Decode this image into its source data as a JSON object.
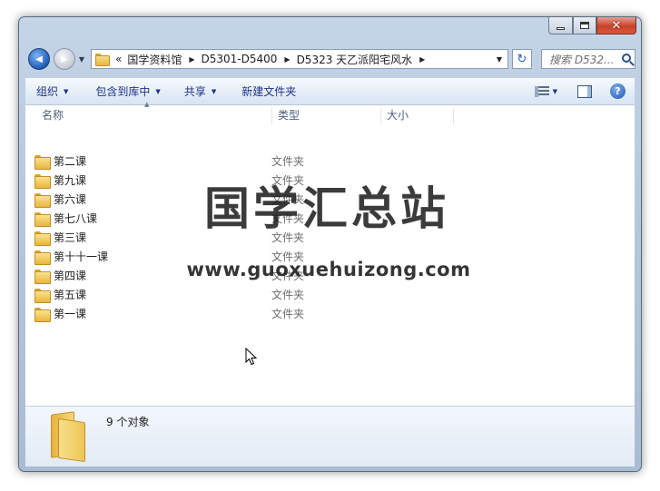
{
  "window": {
    "caption_buttons": {
      "minimize": "minimize",
      "maximize": "maximize",
      "close": "✕"
    }
  },
  "nav": {
    "back_glyph": "◀",
    "forward_glyph": "▶",
    "history_glyph": "▼",
    "breadcrumb_overflow": "«",
    "breadcrumbs": [
      "国学资料馆",
      "D5301-D5400",
      "D5323 天乙派阳宅风水"
    ],
    "crumb_arrow": "▶",
    "dropdown_glyph": "▼",
    "refresh_glyph": "↻",
    "search_placeholder": "搜索 D532..."
  },
  "toolbar": {
    "organize": "组织",
    "include_in_library": "包含到库中",
    "share": "共享",
    "new_folder": "新建文件夹",
    "caret": "▼"
  },
  "columns": {
    "name": "名称",
    "type": "类型",
    "size": "大小"
  },
  "files": [
    {
      "name": "第二课",
      "type": "文件夹"
    },
    {
      "name": "第九课",
      "type": "文件夹"
    },
    {
      "name": "第六课",
      "type": "文件夹"
    },
    {
      "name": "第七八课",
      "type": "文件夹"
    },
    {
      "name": "第三课",
      "type": "文件夹"
    },
    {
      "name": "第十十一课",
      "type": "文件夹"
    },
    {
      "name": "第四课",
      "type": "文件夹"
    },
    {
      "name": "第五课",
      "type": "文件夹"
    },
    {
      "name": "第一课",
      "type": "文件夹"
    }
  ],
  "watermark": {
    "title": "国学汇总站",
    "url": "www.guoxuehuizong.com"
  },
  "details": {
    "item_count": "9 个对象"
  },
  "colors": {
    "toolbar_text": "#1e3287",
    "folder_yellow": "#e8b63d",
    "close_red": "#c8412b"
  }
}
